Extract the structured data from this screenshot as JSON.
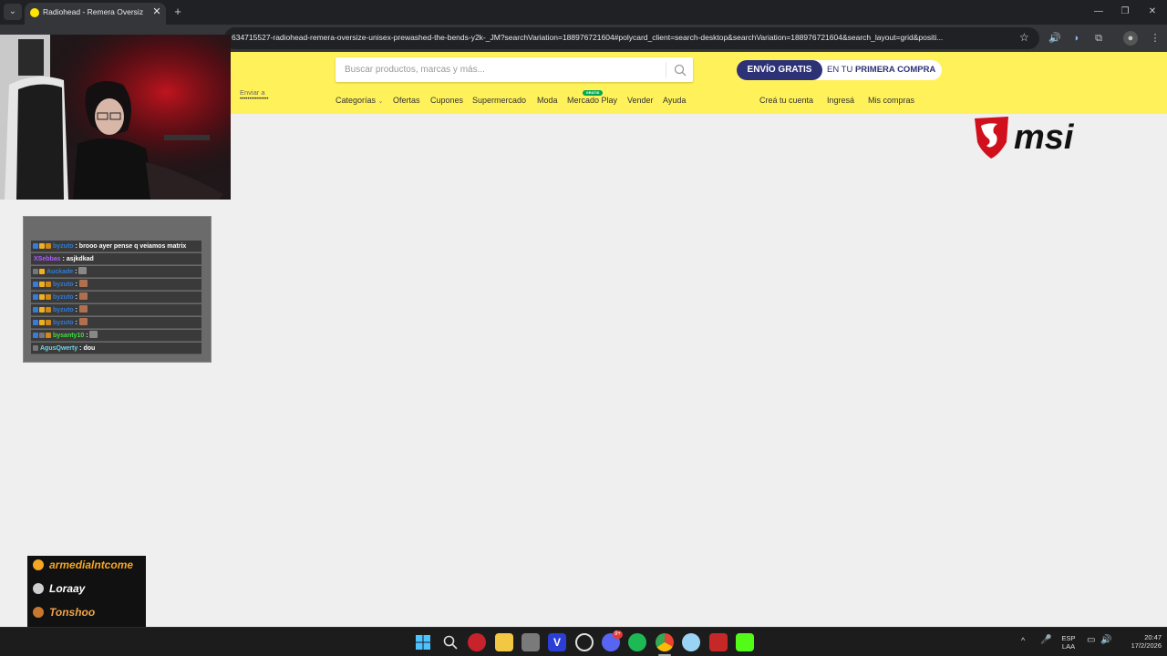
{
  "browser": {
    "tab_title": "Radiohead - Remera Oversize U",
    "url": "634715527-radiohead-remera-oversize-unisex-prewashed-the-bends-y2k-_JM?searchVariation=188976721604#polycard_client=search-desktop&searchVariation=188976721604&search_layout=grid&positi..."
  },
  "header": {
    "search_placeholder": "Buscar productos, marcas y más...",
    "promo_left": "ENVÍO GRATIS",
    "promo_right_prefix": "EN TU ",
    "promo_right_bold": "PRIMERA COMPRA",
    "deliver_label": "Enviar a",
    "deliver_address": "•••••••••••••••",
    "nav": [
      "Categorías",
      "Ofertas",
      "Cupones",
      "Supermercado",
      "Moda",
      "Mercado Play",
      "Vender",
      "Ayuda"
    ],
    "nav_badge": "GRATIS",
    "account": [
      "Creá tu cuenta",
      "Ingresá",
      "Mis compras"
    ]
  },
  "overlay": {
    "sponsor_logo_text": "msi",
    "chat": [
      {
        "user": "byzuto",
        "user_color": "#2f7bd8",
        "message": "brooo ayer pense q veiamos matrix"
      },
      {
        "user": "XSebbas",
        "user_color": "#b05cff",
        "message": "asjkdkad"
      },
      {
        "user": "Auckade",
        "user_color": "#2f7bd8",
        "message": ""
      },
      {
        "user": "byzuto",
        "user_color": "#2f7bd8",
        "message": ""
      },
      {
        "user": "byzuto",
        "user_color": "#2f7bd8",
        "message": ""
      },
      {
        "user": "byzuto",
        "user_color": "#2f7bd8",
        "message": ""
      },
      {
        "user": "byzuto",
        "user_color": "#2f7bd8",
        "message": ""
      },
      {
        "user": "bysanty10",
        "user_color": "#3de03d",
        "message": ""
      },
      {
        "user": "AgusQwerty",
        "user_color": "#6fd6e6",
        "message": "dou"
      }
    ],
    "top_contributors": [
      {
        "name": "armedialntcome",
        "color": "#f5a623",
        "medal_color": "#f5a623"
      },
      {
        "name": "Loraay",
        "color": "#ffffff",
        "medal_color": "#cfcfcf"
      },
      {
        "name": "Tonshoo",
        "color": "#f0a34a",
        "medal_color": "#c9772e"
      }
    ]
  },
  "taskbar": {
    "lang_top": "ESP",
    "lang_bottom": "LAA",
    "time": "20:47",
    "date": "17/2/2026",
    "discord_badge": "9+"
  }
}
